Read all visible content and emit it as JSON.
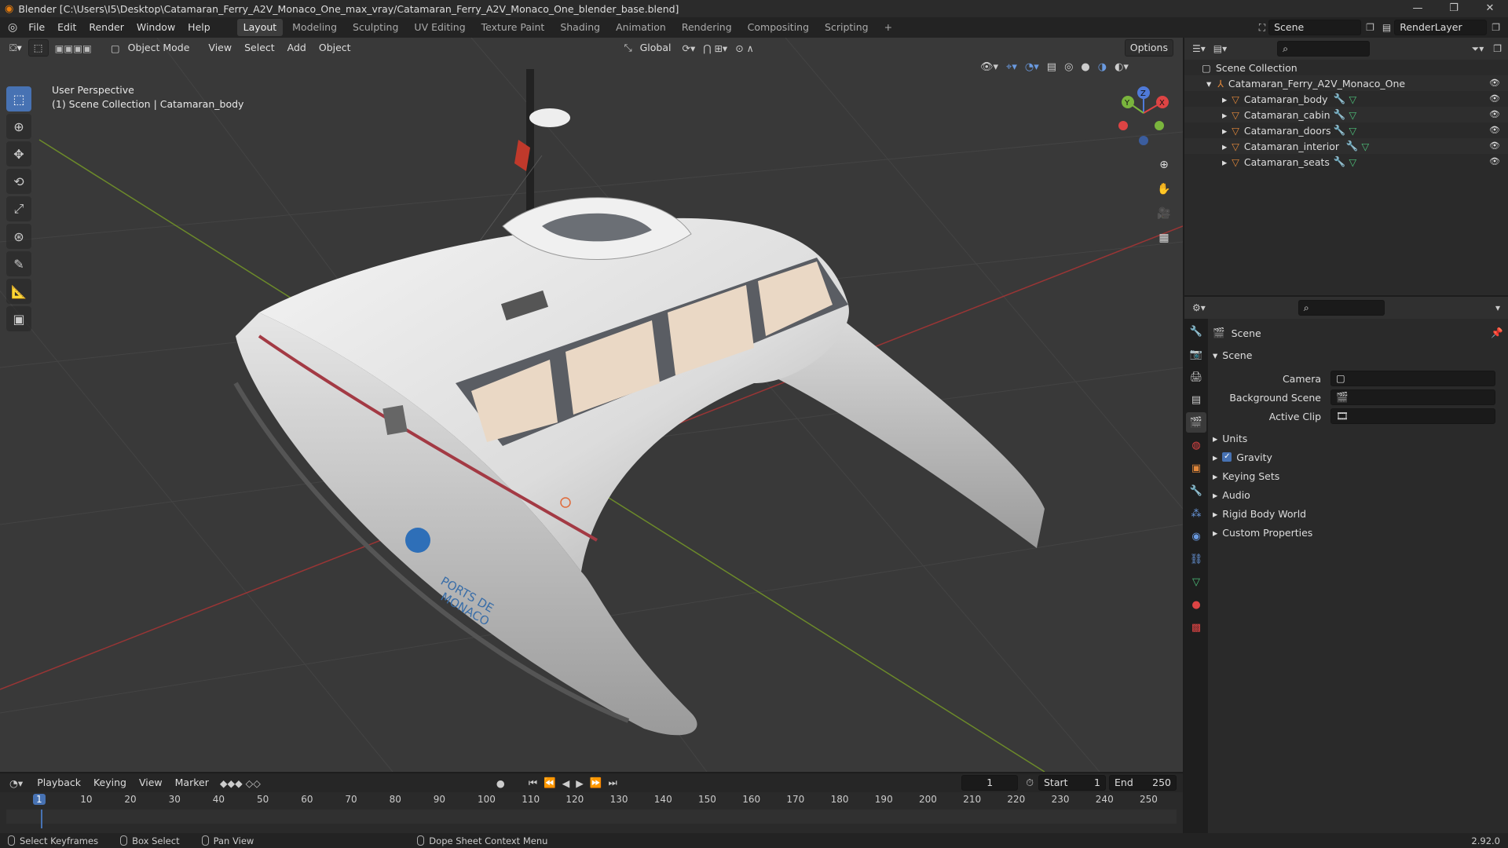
{
  "window": {
    "title": "Blender [C:\\Users\\I5\\Desktop\\Catamaran_Ferry_A2V_Monaco_One_max_vray/Catamaran_Ferry_A2V_Monaco_One_blender_base.blend]",
    "minimize": "—",
    "maximize": "❐",
    "close": "✕"
  },
  "menu": [
    "File",
    "Edit",
    "Render",
    "Window",
    "Help"
  ],
  "workspaces": [
    "Layout",
    "Modeling",
    "Sculpting",
    "UV Editing",
    "Texture Paint",
    "Shading",
    "Animation",
    "Rendering",
    "Compositing",
    "Scripting",
    "+"
  ],
  "scene_field": "Scene",
  "renderlayer_field": "RenderLayer",
  "viewport": {
    "mode": "Object Mode",
    "menus": [
      "View",
      "Select",
      "Add",
      "Object"
    ],
    "transform_orientation": "Global",
    "options": "Options",
    "overlay_line1": "User Perspective",
    "overlay_line2": "(1) Scene Collection | Catamaran_body",
    "gizmo": {
      "x": "X",
      "y": "Y",
      "z": "Z"
    },
    "hull_text1": "PORTS DE",
    "hull_text2": "MONACO"
  },
  "outliner": {
    "root": "Scene Collection",
    "collection": "Catamaran_Ferry_A2V_Monaco_One",
    "objects": [
      "Catamaran_body",
      "Catamaran_cabin",
      "Catamaran_doors",
      "Catamaran_interior",
      "Catamaran_seats"
    ]
  },
  "properties": {
    "header": "Scene",
    "panel": "Scene",
    "camera_label": "Camera",
    "bgscene_label": "Background Scene",
    "activeclip_label": "Active Clip",
    "sections": [
      "Units",
      "Gravity",
      "Keying Sets",
      "Audio",
      "Rigid Body World",
      "Custom Properties"
    ],
    "gravity_checked": true
  },
  "timeline": {
    "menus": [
      "Playback",
      "Keying",
      "View",
      "Marker"
    ],
    "current_frame": "1",
    "start_label": "Start",
    "start": "1",
    "end_label": "End",
    "end": "250",
    "ruler": [
      "1",
      "10",
      "20",
      "30",
      "40",
      "50",
      "60",
      "70",
      "80",
      "90",
      "100",
      "110",
      "120",
      "130",
      "140",
      "150",
      "160",
      "170",
      "180",
      "190",
      "200",
      "210",
      "220",
      "230",
      "240",
      "250"
    ]
  },
  "status": {
    "items": [
      "Select Keyframes",
      "Box Select",
      "Pan View",
      "Dope Sheet Context Menu"
    ],
    "version": "2.92.0"
  },
  "colors": {
    "accent": "#4772b3",
    "mesh": "#e0873a",
    "grid_x": "#9a3535",
    "grid_y": "#6c8a2a"
  }
}
